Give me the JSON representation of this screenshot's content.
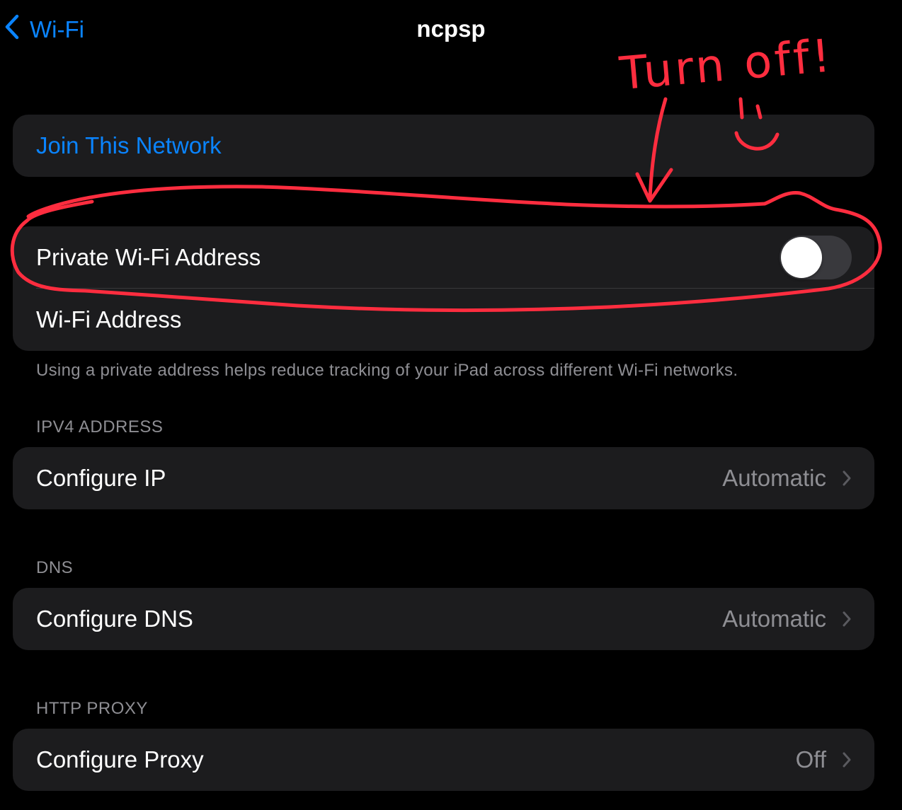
{
  "nav": {
    "back_label": "Wi-Fi",
    "title": "ncpsp"
  },
  "join": {
    "label": "Join This Network"
  },
  "privacy": {
    "private_address_label": "Private Wi-Fi Address",
    "private_address_on": false,
    "wifi_address_label": "Wi-Fi Address",
    "footer": "Using a private address helps reduce tracking of your iPad across different Wi-Fi networks."
  },
  "ipv4": {
    "header": "IPV4 ADDRESS",
    "label": "Configure IP",
    "value": "Automatic"
  },
  "dns": {
    "header": "DNS",
    "label": "Configure DNS",
    "value": "Automatic"
  },
  "proxy": {
    "header": "HTTP PROXY",
    "label": "Configure Proxy",
    "value": "Off"
  },
  "annotation": {
    "text": "Turn off!"
  },
  "colors": {
    "background": "#000000",
    "group_background": "#1c1c1e",
    "accent": "#0a84ff",
    "secondary_text": "#8e8e93",
    "annotation_red": "#ff2d3f"
  },
  "icons": {
    "back": "chevron-left-icon",
    "disclosure": "chevron-right-icon"
  }
}
